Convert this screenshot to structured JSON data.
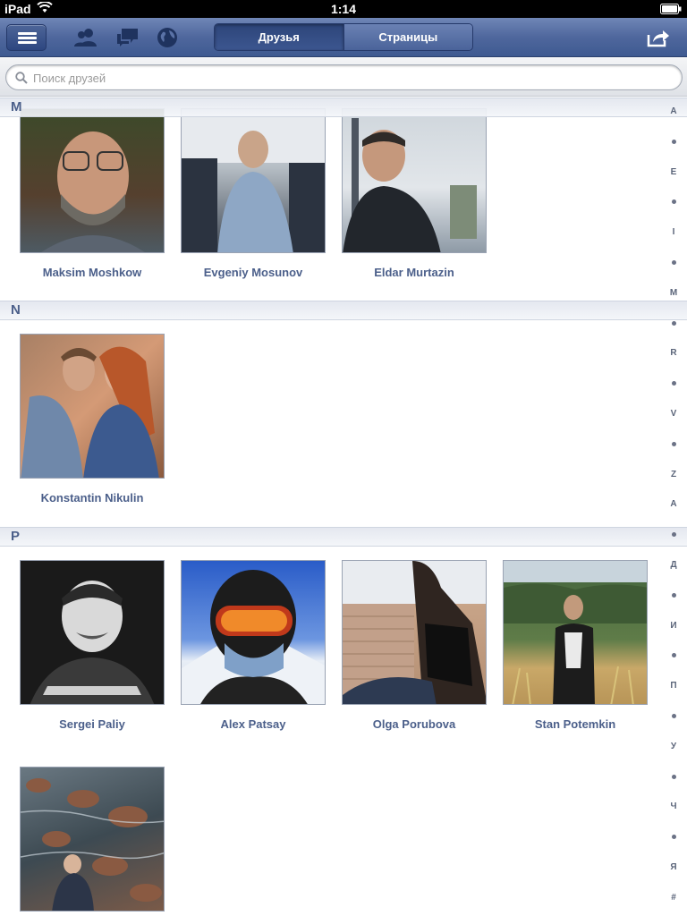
{
  "status_bar": {
    "device": "iPad",
    "time": "1:14",
    "icons": [
      "wifi-icon",
      "battery-icon"
    ]
  },
  "nav_bar": {
    "menu_icon": "menu-icon",
    "icons": [
      "friend-requests-icon",
      "messages-icon",
      "notifications-globe-icon",
      "share-icon"
    ],
    "segments": [
      {
        "label": "Друзья",
        "selected": true
      },
      {
        "label": "Страницы",
        "selected": false
      }
    ],
    "accent": "#3e5a91"
  },
  "search": {
    "placeholder": "Поиск друзей",
    "value": ""
  },
  "sections": [
    {
      "letter": "M",
      "friends": [
        {
          "name": "Maksim Moshkow",
          "photo": "portrait-bearded-man-glasses"
        },
        {
          "name": "Evgeniy Mosunov",
          "photo": "man-on-bus"
        },
        {
          "name": "Eldar Murtazin",
          "photo": "man-in-ferris-wheel-cabin"
        }
      ]
    },
    {
      "letter": "N",
      "friends": [
        {
          "name": "Konstantin  Nikulin",
          "photo": "couple-embracing"
        }
      ]
    },
    {
      "letter": "P",
      "friends": [
        {
          "name": "Sergei Paliy",
          "photo": "smiling-man-bw"
        },
        {
          "name": "Alex Patsay",
          "photo": "skier-goggles"
        },
        {
          "name": "Olga Porubova",
          "photo": "woman-sitting-brick-wall"
        },
        {
          "name": "Stan Potemkin",
          "photo": "man-in-field"
        },
        {
          "name": "",
          "photo": "person-on-rocks-by-water"
        }
      ]
    }
  ],
  "index": [
    "A",
    "•",
    "E",
    "•",
    "I",
    "•",
    "M",
    "•",
    "R",
    "•",
    "V",
    "•",
    "Z",
    "A",
    "•",
    "Д",
    "•",
    "И",
    "•",
    "П",
    "•",
    "У",
    "•",
    "Ч",
    "•",
    "Я",
    "#"
  ]
}
